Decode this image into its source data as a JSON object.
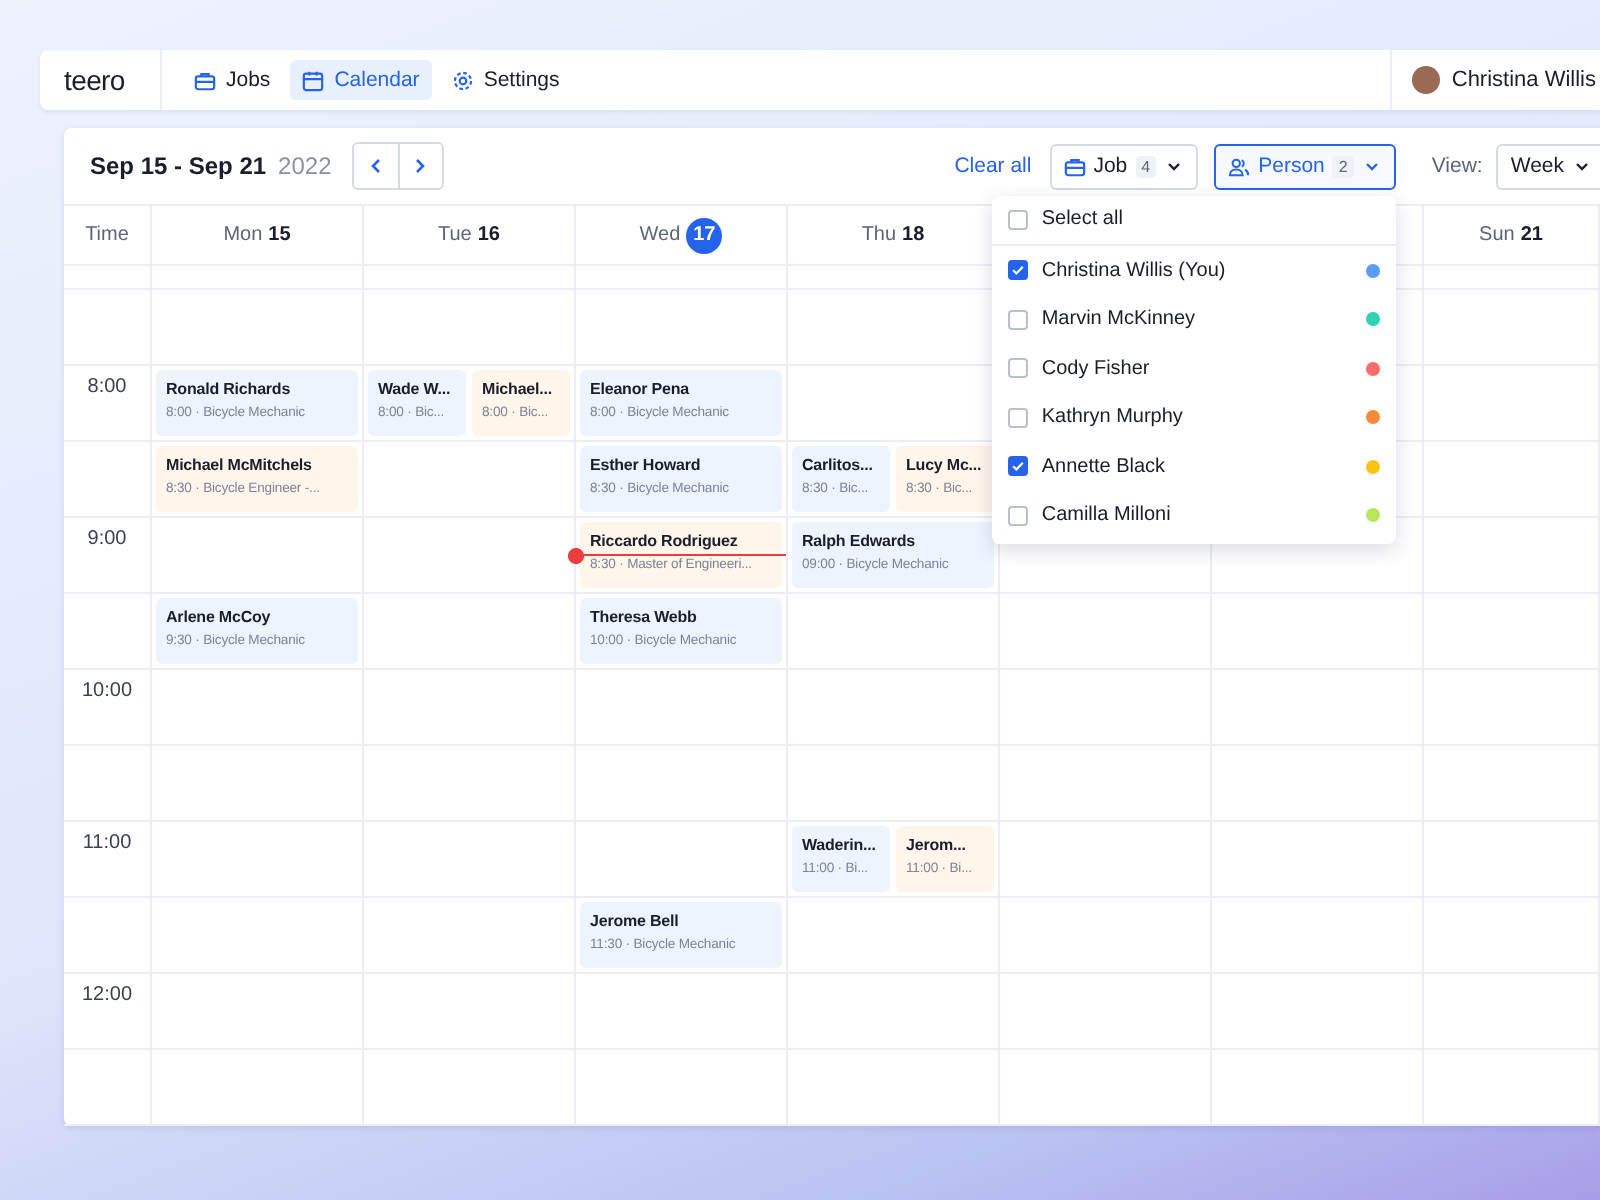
{
  "nav": {
    "logo": "teero",
    "tabs": [
      {
        "label": "Jobs",
        "kind": "jobs",
        "selected": false
      },
      {
        "label": "Calendar",
        "kind": "calendar",
        "selected": true
      },
      {
        "label": "Settings",
        "kind": "settings",
        "selected": false
      }
    ],
    "user": {
      "name": "Christina Willis"
    }
  },
  "toolbar": {
    "range": "Sep 15 - Sep 21",
    "year": "2022",
    "clear": "Clear all",
    "filters": [
      {
        "label": "Job",
        "count": "4",
        "kind": "job",
        "open": false
      },
      {
        "label": "Person",
        "count": "2",
        "kind": "person",
        "open": true
      }
    ],
    "view_label": "View:",
    "view": "Week"
  },
  "person_menu": {
    "select_all": {
      "label": "Select all",
      "checked": false
    },
    "items": [
      {
        "name": "Christina Willis (You)",
        "checked": true,
        "color": "#5b9cf7"
      },
      {
        "name": "Marvin McKinney",
        "checked": false,
        "color": "#2ed3b7"
      },
      {
        "name": "Cody Fisher",
        "checked": false,
        "color": "#f76b6b"
      },
      {
        "name": "Kathryn Murphy",
        "checked": false,
        "color": "#f58a3a"
      },
      {
        "name": "Annette Black",
        "checked": true,
        "color": "#f8c313"
      },
      {
        "name": "Camilla Milloni",
        "checked": false,
        "color": "#b8e65b"
      }
    ]
  },
  "calendar": {
    "time_header": "Time",
    "days": [
      {
        "name": "Mon",
        "date": "15",
        "today": false
      },
      {
        "name": "Tue",
        "date": "16",
        "today": false
      },
      {
        "name": "Wed",
        "date": "17",
        "today": true
      },
      {
        "name": "Thu",
        "date": "18",
        "today": false
      }
    ],
    "last_day": {
      "name": "Sun",
      "date": "21",
      "today": false
    },
    "rows": [
      {
        "cells": [
          [],
          [],
          [],
          [],
          [],
          [],
          []
        ]
      },
      {
        "time": "8:00",
        "cells": [
          [
            {
              "name": "Ronald Richards",
              "detail": "8:00 · Bicycle Mechanic",
              "color": "#eef4fe"
            }
          ],
          [
            {
              "name": "Wade W...",
              "detail": "8:00 · Bic...",
              "color": "#eef4fe"
            },
            {
              "name": "Michael...",
              "detail": "8:00 · Bic...",
              "color": "#fff5ea"
            }
          ],
          [
            {
              "name": "Eleanor Pena",
              "detail": "8:00 · Bicycle Mechanic",
              "color": "#eef4fe"
            }
          ],
          [],
          [],
          [],
          []
        ]
      },
      {
        "cells": [
          [
            {
              "name": "Michael McMitchels",
              "detail": "8:30 · Bicycle Engineer -...",
              "color": "#fff5ea"
            }
          ],
          [],
          [
            {
              "name": "Esther Howard",
              "detail": "8:30 · Bicycle Mechanic",
              "color": "#eef4fe"
            }
          ],
          [
            {
              "name": "Carlitos...",
              "detail": "8:30 · Bic...",
              "color": "#eef4fe"
            },
            {
              "name": "Lucy Mc...",
              "detail": "8:30 · Bic...",
              "color": "#fff5ea"
            }
          ],
          [],
          [],
          []
        ]
      },
      {
        "time": "9:00",
        "current_time": true,
        "cells": [
          [],
          [],
          [
            {
              "name": "Riccardo Rodriguez",
              "detail": "8:30 · Master of Engineeri...",
              "color": "#fff5ea"
            }
          ],
          [
            {
              "name": "Ralph Edwards",
              "detail": "09:00 · Bicycle Mechanic",
              "color": "#eef4fe"
            }
          ],
          [],
          [],
          []
        ]
      },
      {
        "cells": [
          [
            {
              "name": "Arlene McCoy",
              "detail": "9:30 · Bicycle Mechanic",
              "color": "#eef4fe"
            }
          ],
          [],
          [
            {
              "name": "Theresa Webb",
              "detail": "10:00 · Bicycle Mechanic",
              "color": "#eef4fe"
            }
          ],
          [],
          [],
          [],
          []
        ]
      },
      {
        "time": "10:00",
        "cells": [
          [],
          [],
          [],
          [],
          [],
          [],
          []
        ]
      },
      {
        "cells": [
          [],
          [],
          [],
          [],
          [],
          [],
          []
        ]
      },
      {
        "time": "11:00",
        "cells": [
          [],
          [],
          [],
          [
            {
              "name": "Waderin...",
              "detail": "11:00 · Bi...",
              "color": "#eef4fe"
            },
            {
              "name": "Jerom...",
              "detail": "11:00 · Bi...",
              "color": "#fff5ea"
            }
          ],
          [],
          [],
          []
        ]
      },
      {
        "cells": [
          [],
          [],
          [
            {
              "name": "Jerome Bell",
              "detail": "11:30 · Bicycle Mechanic",
              "color": "#eef4fe"
            }
          ],
          [],
          [],
          [],
          []
        ]
      },
      {
        "time": "12:00",
        "cells": [
          [],
          [],
          [],
          [],
          [],
          [],
          []
        ]
      },
      {
        "cells": [
          [],
          [],
          [],
          [],
          [],
          [],
          []
        ]
      }
    ]
  }
}
